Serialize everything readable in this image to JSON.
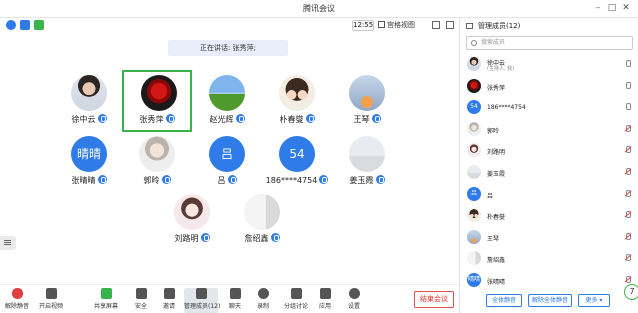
{
  "window": {
    "title": "腾讯会议"
  },
  "topbar": {
    "clock": "12:55",
    "view_label": "宫格视图"
  },
  "speaking": "正在讲话: 张秀萍;",
  "participants": [
    {
      "name": "徐中云",
      "img": "img-woman"
    },
    {
      "name": "张秀萍",
      "img": "img-rose",
      "selected": true
    },
    {
      "name": "赵光辉",
      "img": "img-field"
    },
    {
      "name": "朴春燮",
      "img": "img-couple"
    },
    {
      "name": "王琴",
      "img": "img-rocket"
    },
    {
      "name": "张晴晴",
      "avatar_text": "晴晴"
    },
    {
      "name": "郭昤",
      "img": "img-girl2"
    },
    {
      "name": "吕",
      "avatar_text": "吕"
    },
    {
      "name": "186****4754",
      "avatar_text": "54"
    },
    {
      "name": "姜玉霞",
      "img": "img-beach"
    },
    {
      "name": "刘路明",
      "img": "img-anime"
    },
    {
      "name": "詹绍鑫",
      "img": "img-book"
    }
  ],
  "toolbar": {
    "unmute": "解除静音",
    "video": "开启视频",
    "share": "共享屏幕",
    "security": "安全",
    "invite": "邀请",
    "manage": "管理成员(12)",
    "chat": "聊天",
    "record": "录制",
    "breakout": "分组讨论",
    "apps": "应用",
    "settings": "设置",
    "end": "结束会议"
  },
  "panel": {
    "title": "管理成员(12)",
    "search_placeholder": "搜索成员",
    "members": [
      {
        "name": "徐中云",
        "sub": "(主持人, 我)",
        "img": "img-woman",
        "mic": "on"
      },
      {
        "name": "张秀萍",
        "img": "img-rose",
        "mic": "on"
      },
      {
        "name": "186****4754",
        "avatar_text": "54",
        "mic": "on"
      },
      {
        "name": "郭昤",
        "img": "img-girl2",
        "mic": "off"
      },
      {
        "name": "刘路明",
        "img": "img-anime",
        "mic": "off"
      },
      {
        "name": "姜玉霞",
        "img": "img-beach",
        "mic": "off"
      },
      {
        "name": "吕",
        "avatar_text": "吕",
        "mic": "off"
      },
      {
        "name": "朴春燮",
        "img": "img-couple",
        "mic": "off"
      },
      {
        "name": "王琴",
        "img": "img-rocket",
        "mic": "off"
      },
      {
        "name": "詹绍鑫",
        "img": "img-book",
        "mic": "off"
      },
      {
        "name": "张晴晴",
        "avatar_text": "晴晴",
        "mic": "off"
      }
    ],
    "mute_all": "全体静音",
    "unmute_all": "解除全体静音",
    "more": "更多 ▾"
  },
  "badge": "7",
  "colors": {
    "accent": "#2f7be8",
    "end": "#e03030",
    "selected": "#3bb34d"
  }
}
